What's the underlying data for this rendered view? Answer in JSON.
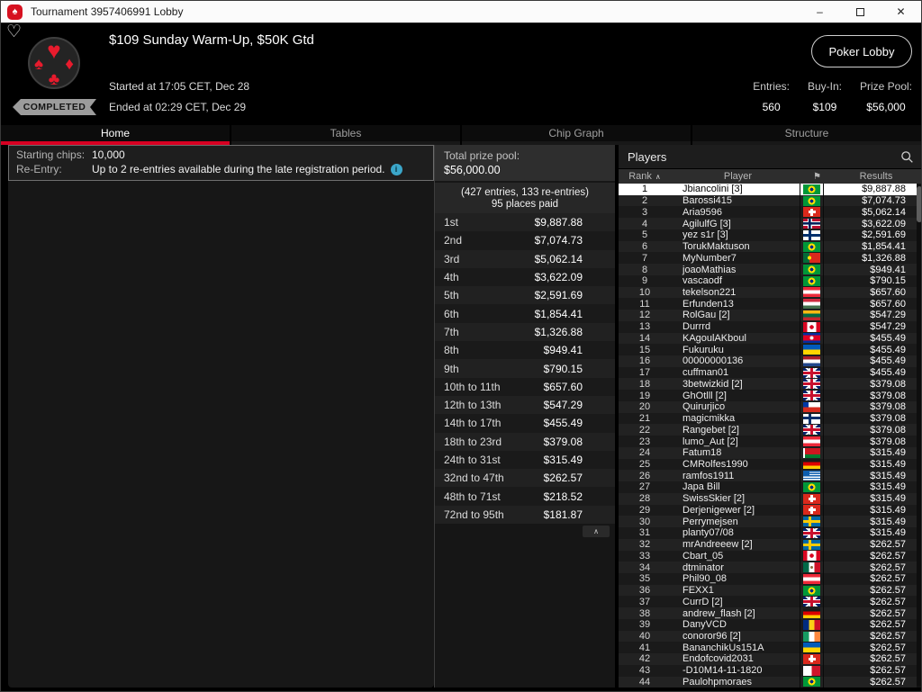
{
  "window": {
    "title": "Tournament 3957406991 Lobby"
  },
  "icons": {
    "logo_spade": "♠",
    "favorite_heart": "♡",
    "suits": [
      "♥",
      "♠",
      "♦",
      "♣"
    ],
    "minimize": "–",
    "close": "✕",
    "sort_asc": "∧",
    "flag_header": "⚑",
    "collapse": "∧",
    "info": "i"
  },
  "colors": {
    "accent_red": "#d70022",
    "brand_red": "#d6101f",
    "info_icon": "#3ba6c9",
    "selected_row": "#ffffff",
    "badge_gray": "#9c9c9c"
  },
  "header": {
    "title": "$109 Sunday Warm-Up, $50K Gtd",
    "started": "Started at 17:05 CET, Dec 28",
    "ended": "Ended at 02:29 CET, Dec 29",
    "status": "COMPLETED",
    "lobby_button": "Poker Lobby",
    "stats": [
      {
        "label": "Entries:",
        "value": "560"
      },
      {
        "label": "Buy-In:",
        "value": "$109"
      },
      {
        "label": "Prize Pool:",
        "value": "$56,000"
      }
    ]
  },
  "tabs": [
    {
      "label": "Home",
      "active": true
    },
    {
      "label": "Tables",
      "active": false
    },
    {
      "label": "Chip Graph",
      "active": false
    },
    {
      "label": "Structure",
      "active": false
    }
  ],
  "info_box": {
    "rows": [
      {
        "label": "Starting chips:",
        "value": "10,000",
        "info": false
      },
      {
        "label": "Re-Entry:",
        "value": "Up to 2 re-entries available during the late registration period.",
        "info": true
      }
    ]
  },
  "prize_panel": {
    "header_label": "Total prize pool:",
    "header_value": "$56,000.00",
    "entries_line": "(427 entries, 133 re-entries)",
    "places_line": "95 places paid",
    "payouts": [
      {
        "place": "1st",
        "amount": "$9,887.88"
      },
      {
        "place": "2nd",
        "amount": "$7,074.73"
      },
      {
        "place": "3rd",
        "amount": "$5,062.14"
      },
      {
        "place": "4th",
        "amount": "$3,622.09"
      },
      {
        "place": "5th",
        "amount": "$2,591.69"
      },
      {
        "place": "6th",
        "amount": "$1,854.41"
      },
      {
        "place": "7th",
        "amount": "$1,326.88"
      },
      {
        "place": "8th",
        "amount": "$949.41"
      },
      {
        "place": "9th",
        "amount": "$790.15"
      },
      {
        "place": "10th to 11th",
        "amount": "$657.60"
      },
      {
        "place": "12th to 13th",
        "amount": "$547.29"
      },
      {
        "place": "14th to 17th",
        "amount": "$455.49"
      },
      {
        "place": "18th to 23rd",
        "amount": "$379.08"
      },
      {
        "place": "24th to 31st",
        "amount": "$315.49"
      },
      {
        "place": "32nd to 47th",
        "amount": "$262.57"
      },
      {
        "place": "48th to 71st",
        "amount": "$218.52"
      },
      {
        "place": "72nd to 95th",
        "amount": "$181.87"
      }
    ]
  },
  "players_panel": {
    "title": "Players",
    "columns": {
      "rank": "Rank",
      "player": "Player",
      "results": "Results"
    },
    "players": [
      {
        "rank": "1",
        "name": "Jbiancolini [3]",
        "country": "brazil",
        "result": "$9,887.88",
        "selected": true
      },
      {
        "rank": "2",
        "name": "Barossi415",
        "country": "brazil",
        "result": "$7,074.73"
      },
      {
        "rank": "3",
        "name": "Aria9596",
        "country": "switzerland",
        "result": "$5,062.14"
      },
      {
        "rank": "4",
        "name": "AgilulfG [3]",
        "country": "norway",
        "result": "$3,622.09"
      },
      {
        "rank": "5",
        "name": "yez s1r [3]",
        "country": "finland",
        "result": "$2,591.69"
      },
      {
        "rank": "6",
        "name": "TorukMaktuson",
        "country": "brazil",
        "result": "$1,854.41"
      },
      {
        "rank": "7",
        "name": "MyNumber7",
        "country": "portugal",
        "result": "$1,326.88"
      },
      {
        "rank": "8",
        "name": "joaoMathias",
        "country": "brazil",
        "result": "$949.41"
      },
      {
        "rank": "9",
        "name": "vascaodf",
        "country": "brazil",
        "result": "$790.15"
      },
      {
        "rank": "10",
        "name": "tekelson221",
        "country": "austria",
        "result": "$657.60"
      },
      {
        "rank": "11",
        "name": "Erfunden13",
        "country": "hungary",
        "result": "$657.60"
      },
      {
        "rank": "12",
        "name": "RolGau [2]",
        "country": "lithuania",
        "result": "$547.29"
      },
      {
        "rank": "13",
        "name": "Durrrd",
        "country": "canada",
        "result": "$547.29"
      },
      {
        "rank": "14",
        "name": "KAgoulAKboul",
        "country": "cambodia",
        "result": "$455.49"
      },
      {
        "rank": "15",
        "name": "Fukuruku",
        "country": "ukraine",
        "result": "$455.49"
      },
      {
        "rank": "16",
        "name": "00000000136",
        "country": "netherlands",
        "result": "$455.49"
      },
      {
        "rank": "17",
        "name": "cuffman01",
        "country": "uk",
        "result": "$455.49"
      },
      {
        "rank": "18",
        "name": "3betwizkid [2]",
        "country": "uk",
        "result": "$379.08"
      },
      {
        "rank": "19",
        "name": "GhOtlll [2]",
        "country": "uk",
        "result": "$379.08"
      },
      {
        "rank": "20",
        "name": "Quirurjico",
        "country": "chile",
        "result": "$379.08"
      },
      {
        "rank": "21",
        "name": "magicmikka",
        "country": "finland",
        "result": "$379.08"
      },
      {
        "rank": "22",
        "name": "Rangebet [2]",
        "country": "uk",
        "result": "$379.08"
      },
      {
        "rank": "23",
        "name": "lumo_Aut [2]",
        "country": "austria",
        "result": "$379.08"
      },
      {
        "rank": "24",
        "name": "Fatum18",
        "country": "belarus",
        "result": "$315.49"
      },
      {
        "rank": "25",
        "name": "CMRolfes1990",
        "country": "germany",
        "result": "$315.49"
      },
      {
        "rank": "26",
        "name": "ramfos1911",
        "country": "greece",
        "result": "$315.49"
      },
      {
        "rank": "27",
        "name": "Japa Bill",
        "country": "brazil",
        "result": "$315.49"
      },
      {
        "rank": "28",
        "name": "SwissSkier [2]",
        "country": "switzerland",
        "result": "$315.49"
      },
      {
        "rank": "29",
        "name": "Derjenigewer [2]",
        "country": "switzerland",
        "result": "$315.49"
      },
      {
        "rank": "30",
        "name": "Perrymejsen",
        "country": "sweden",
        "result": "$315.49"
      },
      {
        "rank": "31",
        "name": "planty07/08",
        "country": "uk",
        "result": "$315.49"
      },
      {
        "rank": "32",
        "name": "mrAndreeew [2]",
        "country": "sweden",
        "result": "$262.57"
      },
      {
        "rank": "33",
        "name": "Cbart_05",
        "country": "canada",
        "result": "$262.57"
      },
      {
        "rank": "34",
        "name": "dtminator",
        "country": "mexico",
        "result": "$262.57"
      },
      {
        "rank": "35",
        "name": "Phil90_08",
        "country": "austria",
        "result": "$262.57"
      },
      {
        "rank": "36",
        "name": "FEXX1",
        "country": "brazil",
        "result": "$262.57"
      },
      {
        "rank": "37",
        "name": "CurrD [2]",
        "country": "uk",
        "result": "$262.57"
      },
      {
        "rank": "38",
        "name": "andrew_flash [2]",
        "country": "germany",
        "result": "$262.57"
      },
      {
        "rank": "39",
        "name": "DanyVCD",
        "country": "romania",
        "result": "$262.57"
      },
      {
        "rank": "40",
        "name": "conoror96 [2]",
        "country": "ireland",
        "result": "$262.57"
      },
      {
        "rank": "41",
        "name": "BananchikUs151A",
        "country": "ukraine",
        "result": "$262.57"
      },
      {
        "rank": "42",
        "name": "Endofcovid2031",
        "country": "switzerland",
        "result": "$262.57"
      },
      {
        "rank": "43",
        "name": "-D10M14-11-1820",
        "country": "malta",
        "result": "$262.57"
      },
      {
        "rank": "44",
        "name": "Paulohpmoraes",
        "country": "brazil",
        "result": "$262.57"
      }
    ]
  }
}
